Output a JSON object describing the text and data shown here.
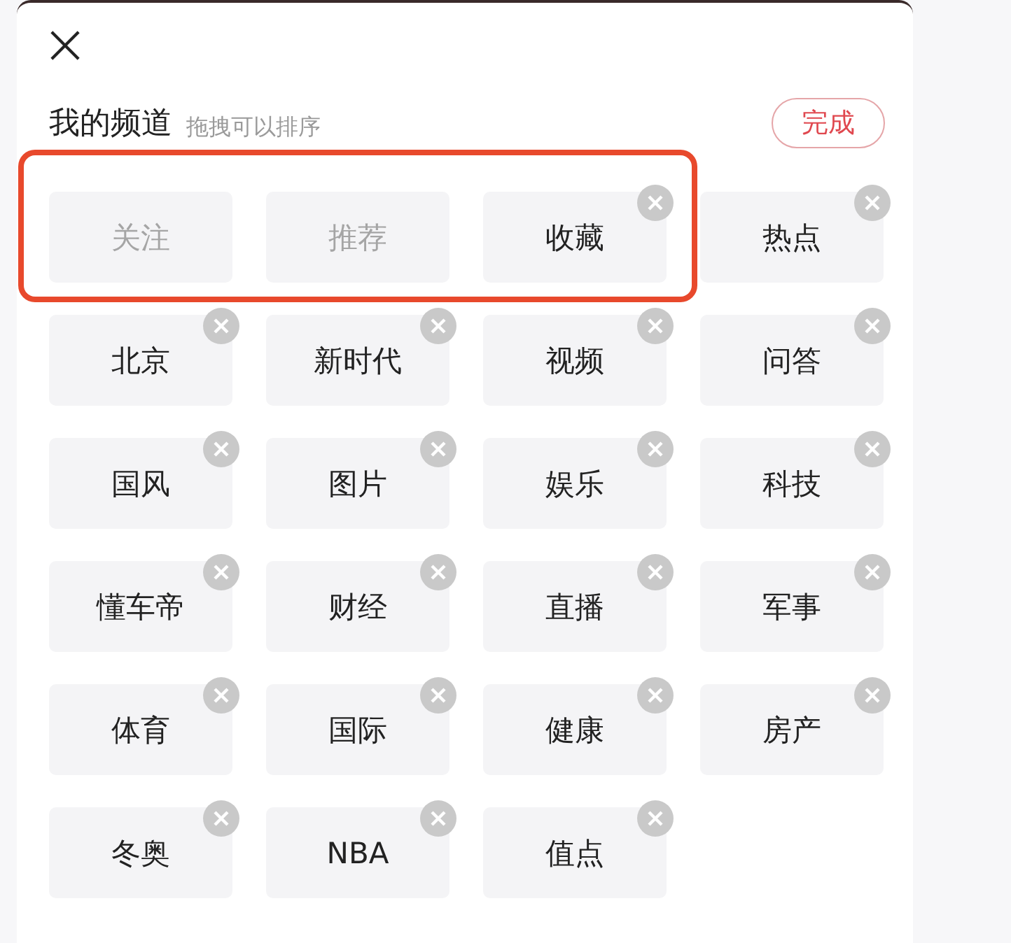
{
  "header": {
    "title": "我的频道",
    "hint": "拖拽可以排序",
    "done_button": "完成"
  },
  "channels": [
    {
      "label": "关注",
      "fixed": true,
      "highlighted": true
    },
    {
      "label": "推荐",
      "fixed": true,
      "highlighted": true
    },
    {
      "label": "收藏",
      "fixed": false,
      "highlighted": true
    },
    {
      "label": "热点",
      "fixed": false,
      "highlighted": false
    },
    {
      "label": "北京",
      "fixed": false,
      "highlighted": false
    },
    {
      "label": "新时代",
      "fixed": false,
      "highlighted": false
    },
    {
      "label": "视频",
      "fixed": false,
      "highlighted": false
    },
    {
      "label": "问答",
      "fixed": false,
      "highlighted": false
    },
    {
      "label": "国风",
      "fixed": false,
      "highlighted": false
    },
    {
      "label": "图片",
      "fixed": false,
      "highlighted": false
    },
    {
      "label": "娱乐",
      "fixed": false,
      "highlighted": false
    },
    {
      "label": "科技",
      "fixed": false,
      "highlighted": false
    },
    {
      "label": "懂车帝",
      "fixed": false,
      "highlighted": false
    },
    {
      "label": "财经",
      "fixed": false,
      "highlighted": false
    },
    {
      "label": "直播",
      "fixed": false,
      "highlighted": false
    },
    {
      "label": "军事",
      "fixed": false,
      "highlighted": false
    },
    {
      "label": "体育",
      "fixed": false,
      "highlighted": false
    },
    {
      "label": "国际",
      "fixed": false,
      "highlighted": false
    },
    {
      "label": "健康",
      "fixed": false,
      "highlighted": false
    },
    {
      "label": "房产",
      "fixed": false,
      "highlighted": false
    },
    {
      "label": "冬奥",
      "fixed": false,
      "highlighted": false
    },
    {
      "label": "NBA",
      "fixed": false,
      "highlighted": false
    },
    {
      "label": "值点",
      "fixed": false,
      "highlighted": false
    }
  ]
}
